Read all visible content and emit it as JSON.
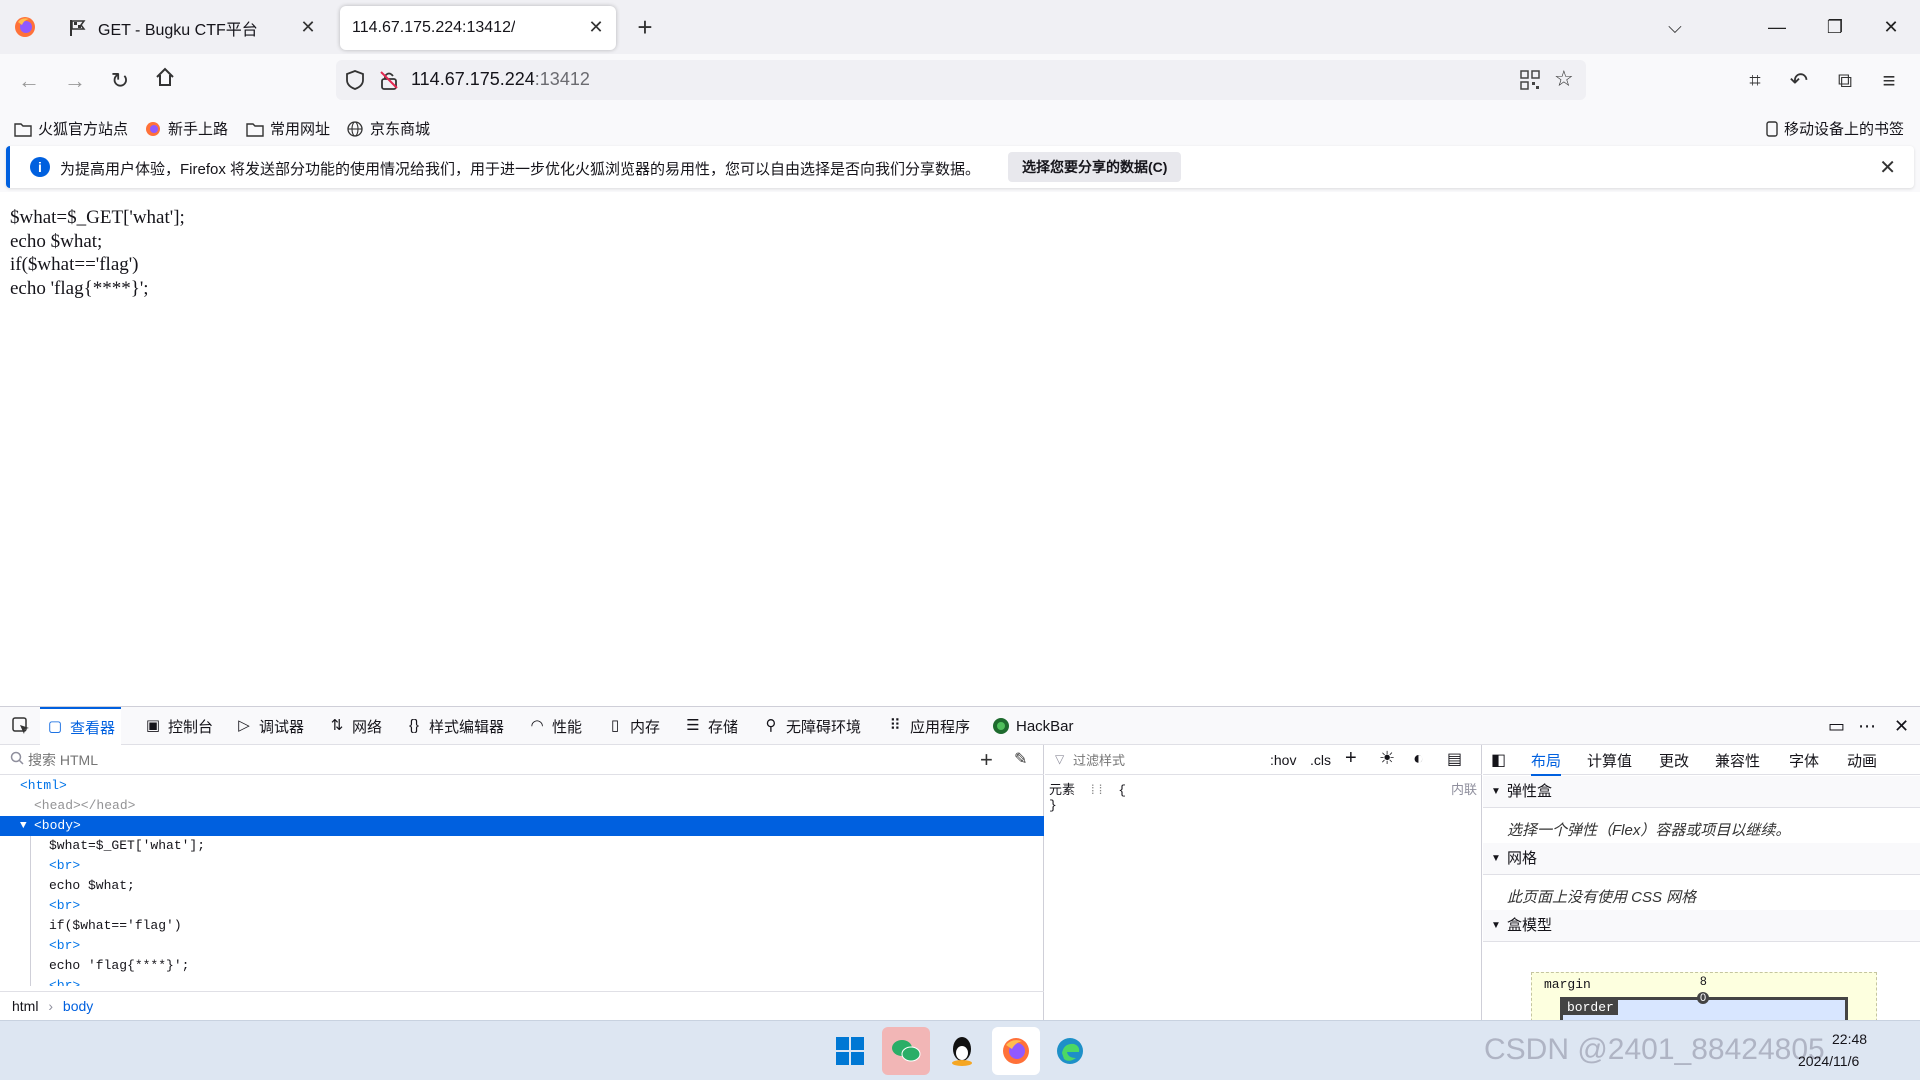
{
  "browser": {
    "tabs": [
      {
        "label": "GET - Bugku CTF平台",
        "selected": false
      },
      {
        "label": "114.67.175.224:13412/",
        "selected": true
      }
    ],
    "new_tab_label": "+",
    "url_host": "114.67.175.224",
    "url_port": ":13412",
    "bookmarks": [
      "火狐官方站点",
      "新手上路",
      "常用网址",
      "京东商城"
    ],
    "mobile_bookmarks": "移动设备上的书签",
    "notification": {
      "message": "为提高用户体验，Firefox 将发送部分功能的使用情况给我们，用于进一步优化火狐浏览器的易用性，您可以自由选择是否向我们分享数据。",
      "action": "选择您要分享的数据(C)"
    }
  },
  "page": {
    "lines": [
      "$what=$_GET['what'];",
      "echo $what;",
      "if($what=='flag')",
      "echo 'flag{****}';"
    ]
  },
  "devtools": {
    "tabs": [
      "查看器",
      "控制台",
      "调试器",
      "网络",
      "样式编辑器",
      "性能",
      "内存",
      "存储",
      "无障碍环境",
      "应用程序",
      "HackBar"
    ],
    "search_placeholder": "搜索 HTML",
    "tree": {
      "html": "<html>",
      "head": "<head></head>",
      "body": "<body>",
      "text1": "$what=$_GET['what'];",
      "br": "<br>",
      "text2": "echo $what;",
      "text3": "if($what=='flag')",
      "text4": "echo 'flag{****}';"
    },
    "breadcrumbs": [
      "html",
      "body"
    ],
    "rules": {
      "filter_placeholder": "过滤样式",
      "hov": ":hov",
      "cls": ".cls",
      "element": "元素",
      "brace_open": "{",
      "brace_close": "}",
      "inline": "内联"
    },
    "layout": {
      "tabs": [
        "布局",
        "计算值",
        "更改",
        "兼容性",
        "字体",
        "动画"
      ],
      "flex_title": "弹性盒",
      "flex_note": "选择一个弹性（Flex）容器或项目以继续。",
      "grid_title": "网格",
      "grid_note": "此页面上没有使用 CSS 网格",
      "box_title": "盒模型",
      "margin_label": "margin",
      "margin_value": "8",
      "border_label": "border",
      "border_value": "0"
    }
  },
  "taskbar": {
    "time": "22:48",
    "date": "2024/11/6",
    "watermark": "CSDN @2401_88424805"
  },
  "colors": {
    "accent": "#0060df",
    "selection": "#0060df"
  }
}
